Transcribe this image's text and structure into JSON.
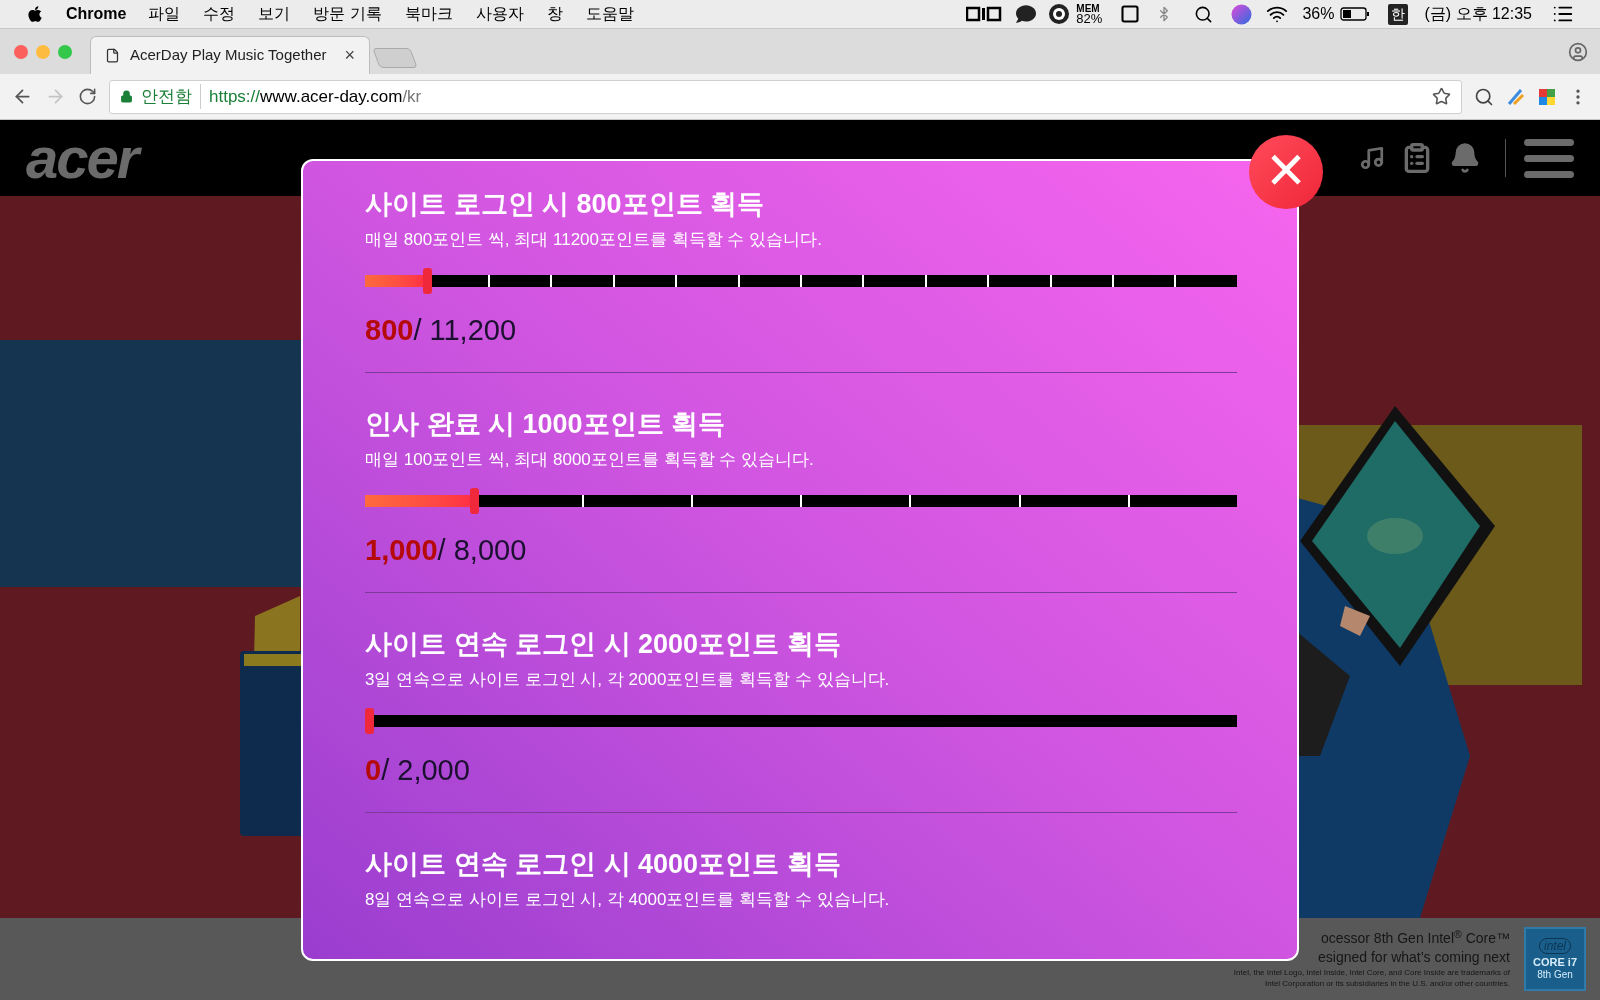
{
  "menu_bar": {
    "app": "Chrome",
    "menus": [
      "파일",
      "수정",
      "보기",
      "방문 기록",
      "북마크",
      "사용자",
      "창",
      "도움말"
    ],
    "memory_label": "MEM",
    "memory_value": "82%",
    "battery": "36%",
    "input_method": "한",
    "clock": "(금) 오후 12:35"
  },
  "browser": {
    "tab": {
      "title": "AcerDay Play Music Together",
      "close": "×"
    },
    "security": "안전함",
    "url": {
      "scheme": "https://",
      "host": "www.acer-day.com",
      "path": "/kr"
    }
  },
  "site_header": {
    "logo": "acer"
  },
  "modal": {
    "close": "×",
    "sections": [
      {
        "title": "사이트 로그인 시 800포인트 획득",
        "description": "매일 800포인트 씩, 최대 11200포인트를 획득할 수 있습니다.",
        "level": 0.0714,
        "earned": "800",
        "total": "/ 11,200"
      },
      {
        "title": "인사 완료 시 1000포인트 획득",
        "description": "매일 100포인트 씩, 최대 8000포인트를 획득할 수 있습니다.",
        "level": 0.125,
        "earned": "1,000",
        "total": "/ 8,000"
      },
      {
        "title": "사이트 연속 로그인 시 2000포인트 획득",
        "description": "3일 연속으로 사이트 로그인 시, 각 2000포인트를 획득할 수 있습니다.",
        "level": 0,
        "earned": "0",
        "total": "/ 2,000"
      },
      {
        "title": "사이트 연속 로그인 시 4000포인트 획득",
        "description": "8일 연속으로 사이트 로그인 시, 각 4000포인트를 획득할 수 있습니다."
      }
    ]
  },
  "footer": {
    "headline": [
      "ocessor 8th Gen Intel$^{®}$ Core™",
      "esigned for what’s coming next"
    ],
    "legal": [
      "Intel, the Intel Logo, Intel Inside, Intel Core, and Core Inside are trademarks of",
      "Intel Corporation or its subsidiaries in the U.S. and/or other countries."
    ],
    "badge": {
      "brand": "intel",
      "model": "CORE i7",
      "generation": "8th Gen"
    }
  }
}
